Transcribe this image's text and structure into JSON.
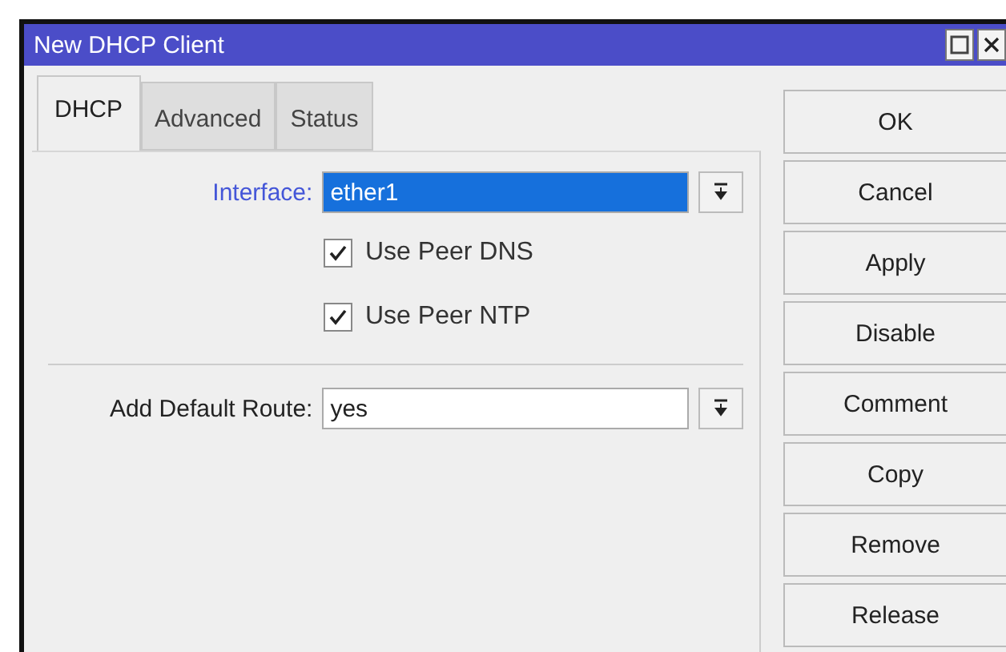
{
  "window": {
    "title": "New DHCP Client"
  },
  "tabs": [
    {
      "label": "DHCP",
      "selected": true
    },
    {
      "label": "Advanced",
      "selected": false
    },
    {
      "label": "Status",
      "selected": false
    }
  ],
  "fields": [
    {
      "kind": "select",
      "label": "Interface:",
      "value": "ether1",
      "selected": true
    },
    {
      "kind": "checkbox",
      "label": "Use Peer DNS",
      "checked": true
    },
    {
      "kind": "checkbox",
      "label": "Use Peer NTP",
      "checked": true
    },
    {
      "kind": "divider"
    },
    {
      "kind": "select",
      "label": "Add Default Route:",
      "value": "yes",
      "selected": false
    }
  ],
  "buttons": [
    "OK",
    "Cancel",
    "Apply",
    "Disable",
    "Comment",
    "Copy",
    "Remove",
    "Release"
  ]
}
